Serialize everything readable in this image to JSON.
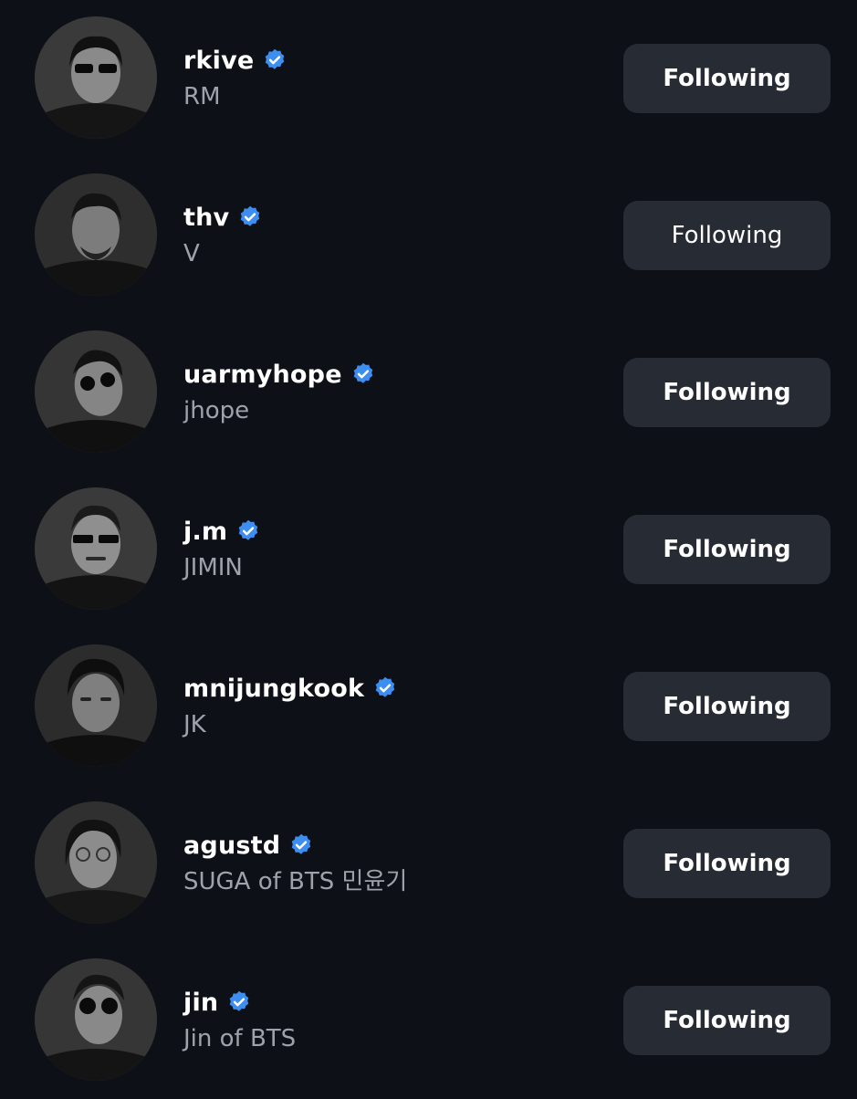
{
  "following_list": [
    {
      "username": "rkive",
      "display_name": "RM",
      "verified": true,
      "button_label": "Following"
    },
    {
      "username": "thv",
      "display_name": "V",
      "verified": true,
      "button_label": "Following"
    },
    {
      "username": "uarmyhope",
      "display_name": "jhope",
      "verified": true,
      "button_label": "Following"
    },
    {
      "username": "j.m",
      "display_name": "JIMIN",
      "verified": true,
      "button_label": "Following"
    },
    {
      "username": "mnijungkook",
      "display_name": "JK",
      "verified": true,
      "button_label": "Following"
    },
    {
      "username": "agustd",
      "display_name": "SUGA of BTS 민윤기",
      "verified": true,
      "button_label": "Following"
    },
    {
      "username": "jin",
      "display_name": "Jin of BTS",
      "verified": true,
      "button_label": "Following"
    }
  ],
  "icons": {
    "verified": "verified-badge-icon",
    "avatar": "profile-photo"
  },
  "colors": {
    "background": "#0d1117",
    "verified_blue": "#3d8ef0",
    "button_bg": "#272b33",
    "secondary_text": "#9ea3ab"
  }
}
